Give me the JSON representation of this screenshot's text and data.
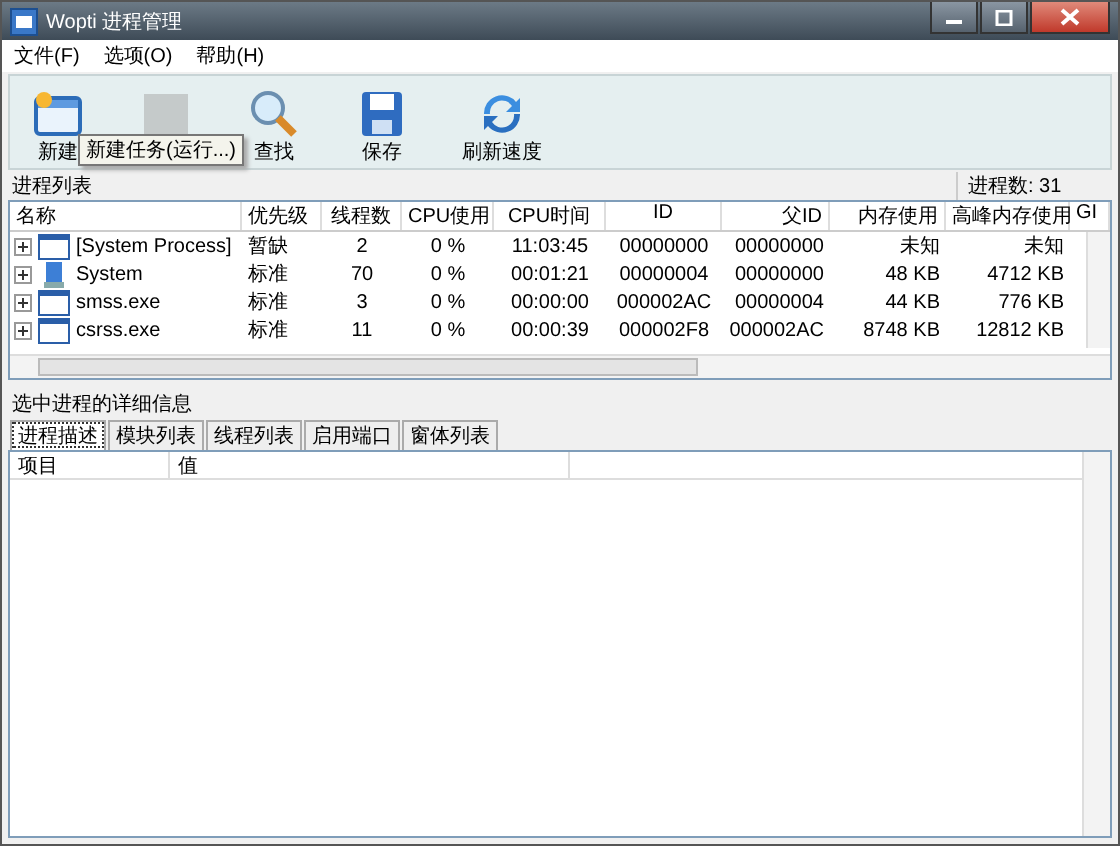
{
  "window": {
    "title": "Wopti 进程管理"
  },
  "menu": [
    "文件(F)",
    "选项(O)",
    "帮助(H)"
  ],
  "toolbar": [
    {
      "label": "新建",
      "kind": "new",
      "disabled": false
    },
    {
      "kind": "stop",
      "disabled": true
    },
    {
      "label": "查找",
      "kind": "find",
      "disabled": false
    },
    {
      "label": "保存",
      "kind": "save",
      "disabled": false
    },
    {
      "label": "刷新速度",
      "kind": "refresh",
      "disabled": false
    }
  ],
  "tooltip": "新建任务(运行...)",
  "process_list": {
    "title": "进程列表",
    "count": "进程数: 31",
    "columns": [
      "名称",
      "优先级",
      "线程数",
      "CPU使用",
      "CPU时间",
      "ID",
      "父ID",
      "内存使用",
      "高峰内存使用",
      "GI"
    ],
    "rows": [
      {
        "kind": "window",
        "cells": [
          "[System Process]",
          "暂缺",
          "2",
          "0 %",
          "11:03:45",
          "00000000",
          "00000000",
          "未知",
          "未知"
        ]
      },
      {
        "kind": "system",
        "cells": [
          "System",
          "标准",
          "70",
          "0 %",
          "00:01:21",
          "00000004",
          "00000000",
          "48 KB",
          "4712 KB"
        ]
      },
      {
        "kind": "window",
        "cells": [
          "smss.exe",
          "标准",
          "3",
          "0 %",
          "00:00:00",
          "000002AC",
          "00000004",
          "44 KB",
          "776 KB"
        ]
      },
      {
        "kind": "window",
        "cells": [
          "csrss.exe",
          "标准",
          "11",
          "0 %",
          "00:00:39",
          "000002F8",
          "000002AC",
          "8748 KB",
          "12812 KB"
        ]
      }
    ]
  },
  "details": {
    "title": "选中进程的详细信息",
    "tabs": [
      {
        "label": "进程描述",
        "selected": true
      },
      {
        "label": "模块列表",
        "selected": false
      },
      {
        "label": "线程列表",
        "selected": false
      },
      {
        "label": "启用端口",
        "selected": false
      },
      {
        "label": "窗体列表",
        "selected": false
      }
    ],
    "columns": [
      "项目",
      "值"
    ]
  }
}
